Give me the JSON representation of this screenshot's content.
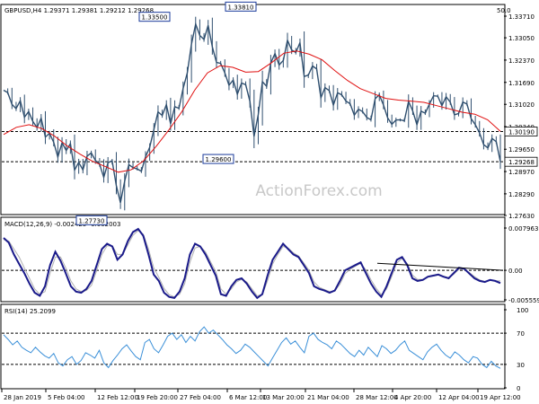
{
  "chart_data": [
    {
      "type": "line",
      "panel": "price",
      "header": "GBPUSD,H4  1.29371 1.29381 1.29212 1.29268",
      "top_right_value": "50.0",
      "watermark": "ActionForex.com",
      "y_ticks": [
        "1.33710",
        "1.33050",
        "1.32370",
        "1.31690",
        "1.31020",
        "1.30340",
        "1.29650",
        "1.28970",
        "1.28290",
        "1.27630"
      ],
      "ylim": [
        1.2763,
        1.3371
      ],
      "price_marker_labels": [
        "1.30190",
        "1.29268"
      ],
      "resistance_line": 1.3019,
      "annotations": [
        {
          "text": "1.33500",
          "value": 1.335
        },
        {
          "text": "1.33810",
          "value": 1.3381
        },
        {
          "text": "1.29600",
          "value": 1.296
        },
        {
          "text": "1.27730",
          "value": 1.2773
        }
      ],
      "series": [
        {
          "values": [
            1.3145,
            1.3138,
            1.3102,
            1.3089,
            1.3113,
            1.3063,
            1.308,
            1.305,
            1.3031,
            1.306,
            1.3002,
            1.3014,
            1.2986,
            1.2941,
            1.2985,
            1.2961,
            1.2982,
            1.2901,
            1.2925,
            1.2902,
            1.2944,
            1.2954,
            1.2931,
            1.2919,
            1.2879,
            1.2924,
            1.293,
            1.2854,
            1.2802,
            1.2868,
            1.2918,
            1.2909,
            1.2905,
            1.2898,
            1.2942,
            1.2971,
            1.3025,
            1.3079,
            1.3068,
            1.3101,
            1.3043,
            1.3095,
            1.309,
            1.315,
            1.3198,
            1.3285,
            1.3347,
            1.3312,
            1.33,
            1.3343,
            1.3277,
            1.323,
            1.3227,
            1.3198,
            1.316,
            1.3176,
            1.3133,
            1.3167,
            1.3162,
            1.3111,
            1.3004,
            1.3071,
            1.3171,
            1.3157,
            1.3228,
            1.3257,
            1.3222,
            1.3236,
            1.3298,
            1.3268,
            1.326,
            1.329,
            1.3187,
            1.3191,
            1.3219,
            1.321,
            1.3122,
            1.3153,
            1.3144,
            1.31,
            1.3137,
            1.3131,
            1.3112,
            1.3104,
            1.3069,
            1.3087,
            1.308,
            1.3062,
            1.3055,
            1.3119,
            1.3131,
            1.31,
            1.3061,
            1.3041,
            1.3054,
            1.3055,
            1.3052,
            1.3111,
            1.3082,
            1.304,
            1.3081,
            1.3075,
            1.3103,
            1.3128,
            1.3127,
            1.3098,
            1.3125,
            1.3109,
            1.307,
            1.3074,
            1.3109,
            1.3103,
            1.3058,
            1.304,
            1.3015,
            1.2979,
            1.2969,
            1.2998,
            1.2988,
            1.2927
          ]
        },
        {
          "name": "MA",
          "values": [
            1.301,
            1.3032,
            1.304,
            1.3028,
            1.3005,
            1.2975,
            1.295,
            1.2928,
            1.2912,
            1.2895,
            1.2902,
            1.293,
            1.2975,
            1.3025,
            1.308,
            1.3145,
            1.3198,
            1.322,
            1.3215,
            1.32,
            1.3202,
            1.3228,
            1.3258,
            1.3265,
            1.3255,
            1.3238,
            1.3205,
            1.3175,
            1.315,
            1.3135,
            1.312,
            1.3115,
            1.3112,
            1.3108,
            1.3098,
            1.3088,
            1.3078,
            1.3072,
            1.3055,
            1.302
          ]
        }
      ],
      "x_ticks": [
        "28 Jan 2019",
        "5 Feb 04:00",
        "12 Feb 12:00",
        "19 Feb 20:00",
        "27 Feb 04:00",
        "6 Mar 12:00",
        "13 Mar 20:00",
        "21 Mar 04:00",
        "28 Mar 12:00",
        "4 Apr 20:00",
        "12 Apr 04:00",
        "19 Apr 12:00"
      ]
    },
    {
      "type": "line",
      "panel": "macd",
      "label": "MACD(12,26,9) -0.002425 -0.002003",
      "y_ticks": [
        "0.007963",
        "0.00",
        "-0.005559"
      ],
      "ylim": [
        -0.005559,
        0.007963
      ],
      "series": [
        {
          "name": "MACD",
          "values": [
            0.0061,
            0.0052,
            0.003,
            0.0012,
            -0.0005,
            -0.0025,
            -0.0042,
            -0.0048,
            -0.003,
            0.001,
            0.0035,
            0.0018,
            -0.0005,
            -0.003,
            -0.004,
            -0.0042,
            -0.0035,
            -0.002,
            0.001,
            0.004,
            0.005,
            0.0045,
            0.002,
            0.003,
            0.0055,
            0.0072,
            0.0078,
            0.0065,
            0.003,
            -0.0008,
            -0.002,
            -0.0042,
            -0.005,
            -0.0052,
            -0.004,
            -0.0015,
            0.003,
            0.005,
            0.0045,
            0.003,
            0.001,
            -0.001,
            -0.0045,
            -0.0048,
            -0.003,
            -0.0018,
            -0.0015,
            -0.0025,
            -0.004,
            -0.0052,
            -0.0045,
            -0.001,
            0.002,
            0.0035,
            0.005,
            0.004,
            0.003,
            0.0025,
            0.001,
            -0.0005,
            -0.003,
            -0.0035,
            -0.0038,
            -0.0042,
            -0.0038,
            -0.002,
            0.0,
            0.0005,
            0.001,
            0.0015,
            -0.0005,
            -0.0025,
            -0.004,
            -0.005,
            -0.003,
            -0.0005,
            0.002,
            0.0025,
            0.001,
            -0.0015,
            -0.002,
            -0.0018,
            -0.0012,
            -0.001,
            -0.0008,
            -0.0012,
            -0.0015,
            -0.0005,
            0.0005,
            0.0003,
            -0.0006,
            -0.0015,
            -0.002,
            -0.0022,
            -0.0018,
            -0.002,
            -0.0024
          ]
        },
        {
          "name": "Signal",
          "values": [
            0.0058,
            0.0055,
            0.004,
            0.0025,
            0.0005,
            -0.0015,
            -0.0035,
            -0.0045,
            -0.004,
            -0.0005,
            0.0025,
            0.0025,
            0.0005,
            -0.002,
            -0.0035,
            -0.004,
            -0.0038,
            -0.0028,
            0.0,
            0.003,
            0.0046,
            0.0046,
            0.003,
            0.003,
            0.0048,
            0.0066,
            0.0075,
            0.0068,
            0.004,
            0.0005,
            -0.0013,
            -0.0034,
            -0.0046,
            -0.005,
            -0.0045,
            -0.0025,
            0.0015,
            0.0042,
            0.0045,
            0.0035,
            0.0016,
            -0.0002,
            -0.0035,
            -0.0045,
            -0.0035,
            -0.0022,
            -0.0017,
            -0.0022,
            -0.0035,
            -0.0048,
            -0.0046,
            -0.002,
            0.0012,
            0.003,
            0.0045,
            0.0042,
            0.0033,
            0.0027,
            0.0014,
            0.0,
            -0.0022,
            -0.0032,
            -0.0036,
            -0.004,
            -0.0039,
            -0.0026,
            -0.0006,
            0.0002,
            0.0008,
            0.0013,
            0.0001,
            -0.0018,
            -0.0034,
            -0.0046,
            -0.0035,
            -0.0012,
            0.0014,
            0.0022,
            0.0013,
            -0.0009,
            -0.0017,
            -0.0017,
            -0.0013,
            -0.0011,
            -0.0009,
            -0.0011,
            -0.0014,
            -0.0007,
            0.0002,
            0.0002,
            -0.0004,
            -0.0012,
            -0.0018,
            -0.0021,
            -0.0019,
            -0.002,
            -0.002
          ]
        }
      ],
      "trendline": [
        0.001,
        0.0
      ]
    },
    {
      "type": "line",
      "panel": "rsi",
      "label": "RSI(14) 25.2099",
      "y_ticks": [
        "100",
        "70",
        "30",
        "0"
      ],
      "ylim": [
        0,
        100
      ],
      "levels": [
        70,
        30
      ],
      "series": [
        {
          "name": "RSI",
          "values": [
            68,
            62,
            55,
            60,
            52,
            48,
            45,
            52,
            46,
            41,
            38,
            44,
            32,
            28,
            36,
            40,
            30,
            35,
            45,
            42,
            38,
            48,
            32,
            26,
            35,
            42,
            50,
            55,
            47,
            40,
            36,
            58,
            62,
            50,
            45,
            55,
            66,
            70,
            62,
            68,
            58,
            66,
            60,
            72,
            78,
            70,
            74,
            68,
            62,
            55,
            50,
            44,
            48,
            56,
            52,
            46,
            40,
            34,
            28,
            38,
            48,
            58,
            64,
            56,
            60,
            52,
            45,
            66,
            70,
            62,
            58,
            55,
            50,
            60,
            56,
            50,
            44,
            40,
            48,
            42,
            52,
            46,
            40,
            54,
            50,
            44,
            48,
            55,
            60,
            48,
            44,
            40,
            36,
            46,
            52,
            56,
            48,
            42,
            38,
            46,
            42,
            36,
            32,
            40,
            38,
            30,
            26,
            34,
            28,
            25
          ]
        }
      ]
    }
  ]
}
